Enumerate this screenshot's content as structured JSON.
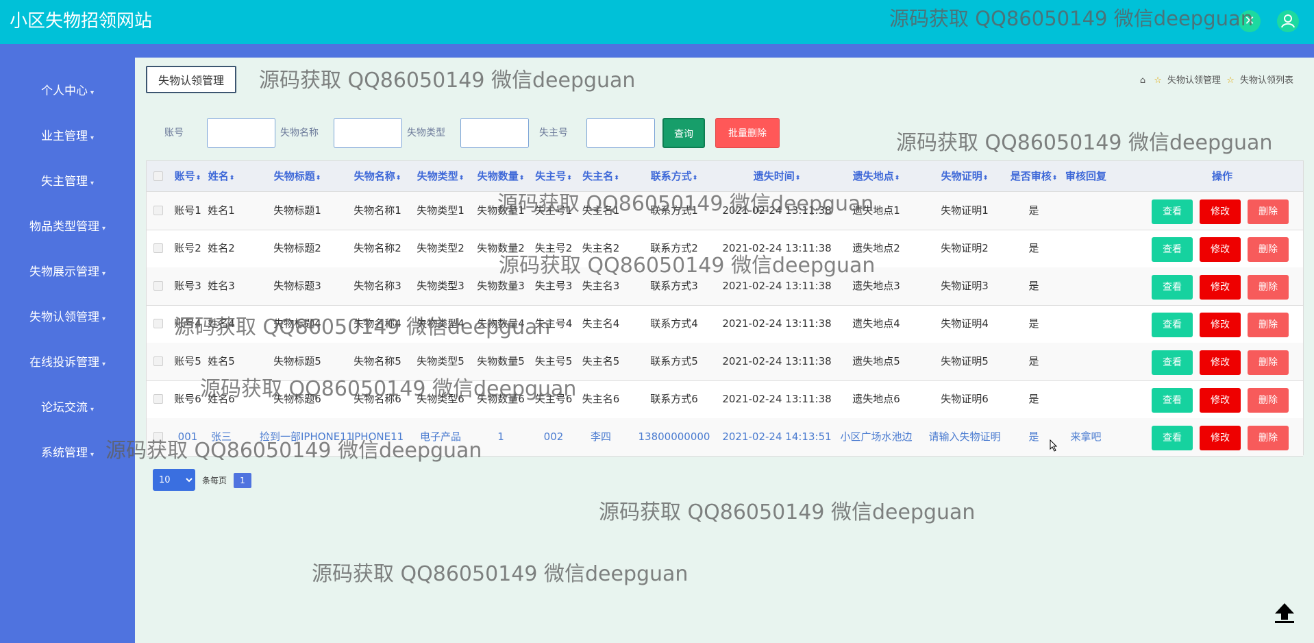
{
  "app": {
    "title": "小区失物招领网站"
  },
  "topbar": {
    "close_icon": "close-icon",
    "user_icon": "user-icon"
  },
  "sidebar": {
    "items": [
      {
        "label": "个人中心"
      },
      {
        "label": "业主管理"
      },
      {
        "label": "失主管理"
      },
      {
        "label": "物品类型管理"
      },
      {
        "label": "失物展示管理"
      },
      {
        "label": "失物认领管理"
      },
      {
        "label": "在线投诉管理"
      },
      {
        "label": "论坛交流"
      },
      {
        "label": "系统管理"
      }
    ]
  },
  "panel": {
    "title": "失物认领管理"
  },
  "breadcrumb": {
    "items": [
      "失物认领管理",
      "失物认领列表"
    ]
  },
  "search": {
    "fields": [
      {
        "label": "账号",
        "value": ""
      },
      {
        "label": "失物名称",
        "value": ""
      },
      {
        "label": "失物类型",
        "value": ""
      },
      {
        "label": "失主号",
        "value": ""
      }
    ],
    "query_label": "查询",
    "batch_delete_label": "批量删除"
  },
  "table": {
    "columns": [
      "账号",
      "姓名",
      "失物标题",
      "失物名称",
      "失物类型",
      "失物数量",
      "失主号",
      "失主名",
      "联系方式",
      "遗失时间",
      "遗失地点",
      "失物证明",
      "是否审核",
      "审核回复",
      "操作"
    ],
    "rows": [
      [
        "账号1",
        "姓名1",
        "失物标题1",
        "失物名称1",
        "失物类型1",
        "失物数量1",
        "失主号1",
        "失主名1",
        "联系方式1",
        "2021-02-24 13:11:38",
        "遗失地点1",
        "失物证明1",
        "是",
        ""
      ],
      [
        "账号2",
        "姓名2",
        "失物标题2",
        "失物名称2",
        "失物类型2",
        "失物数量2",
        "失主号2",
        "失主名2",
        "联系方式2",
        "2021-02-24 13:11:38",
        "遗失地点2",
        "失物证明2",
        "是",
        ""
      ],
      [
        "账号3",
        "姓名3",
        "失物标题3",
        "失物名称3",
        "失物类型3",
        "失物数量3",
        "失主号3",
        "失主名3",
        "联系方式3",
        "2021-02-24 13:11:38",
        "遗失地点3",
        "失物证明3",
        "是",
        ""
      ],
      [
        "账号4",
        "姓名4",
        "失物标题4",
        "失物名称4",
        "失物类型4",
        "失物数量4",
        "失主号4",
        "失主名4",
        "联系方式4",
        "2021-02-24 13:11:38",
        "遗失地点4",
        "失物证明4",
        "是",
        ""
      ],
      [
        "账号5",
        "姓名5",
        "失物标题5",
        "失物名称5",
        "失物类型5",
        "失物数量5",
        "失主号5",
        "失主名5",
        "联系方式5",
        "2021-02-24 13:11:38",
        "遗失地点5",
        "失物证明5",
        "是",
        ""
      ],
      [
        "账号6",
        "姓名6",
        "失物标题6",
        "失物名称6",
        "失物类型6",
        "失物数量6",
        "失主号6",
        "失主名6",
        "联系方式6",
        "2021-02-24 13:11:38",
        "遗失地点6",
        "失物证明6",
        "是",
        ""
      ],
      [
        "001",
        "张三",
        "捡到一部IPHONE11",
        "IPHONE11",
        "电子产品",
        "1",
        "002",
        "李四",
        "13800000000",
        "2021-02-24 14:13:51",
        "小区广场水池边",
        "请输入失物证明",
        "是",
        "来拿吧"
      ]
    ],
    "actions": {
      "view": "查看",
      "edit": "修改",
      "delete": "删除"
    }
  },
  "pager": {
    "page_size": "10",
    "per_page_label": "条每页",
    "current_page": "1"
  },
  "watermark": {
    "text": "源码获取 QQ86050149 微信deepguan"
  },
  "colors": {
    "topbar": "#00c1d8",
    "sidebar": "#4f73df",
    "content_bg": "#e8f4ef",
    "header_text": "#3f69d8",
    "view_btn": "#16d29f",
    "edit_btn": "#ee0000",
    "delete_btn": "#f75b5b"
  }
}
